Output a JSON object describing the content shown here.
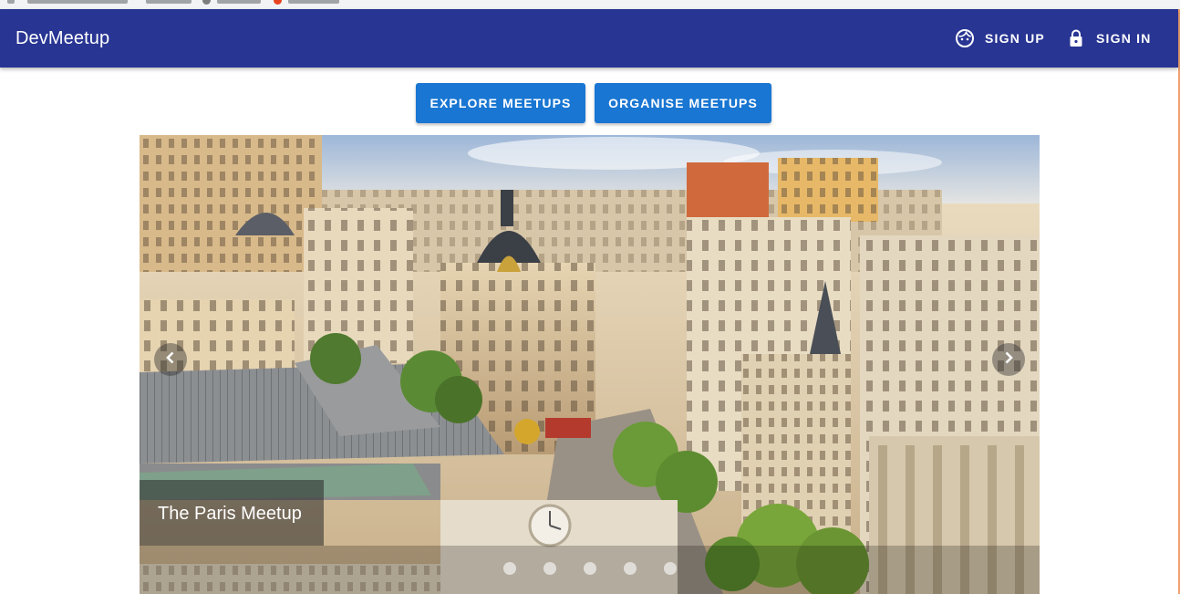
{
  "app_bar": {
    "title": "DevMeetup",
    "sign_up_label": "SIGN UP",
    "sign_in_label": "SIGN IN",
    "background_color": "#283593"
  },
  "actions": {
    "explore_label": "EXPLORE MEETUPS",
    "organise_label": "ORGANISE MEETUPS",
    "button_color": "#1976d2"
  },
  "carousel": {
    "caption": "The Paris Meetup",
    "slide_count": 5
  },
  "icons": {
    "sign_up": "face-icon",
    "sign_in": "lock-icon",
    "prev": "chevron-left-icon",
    "next": "chevron-right-icon"
  }
}
